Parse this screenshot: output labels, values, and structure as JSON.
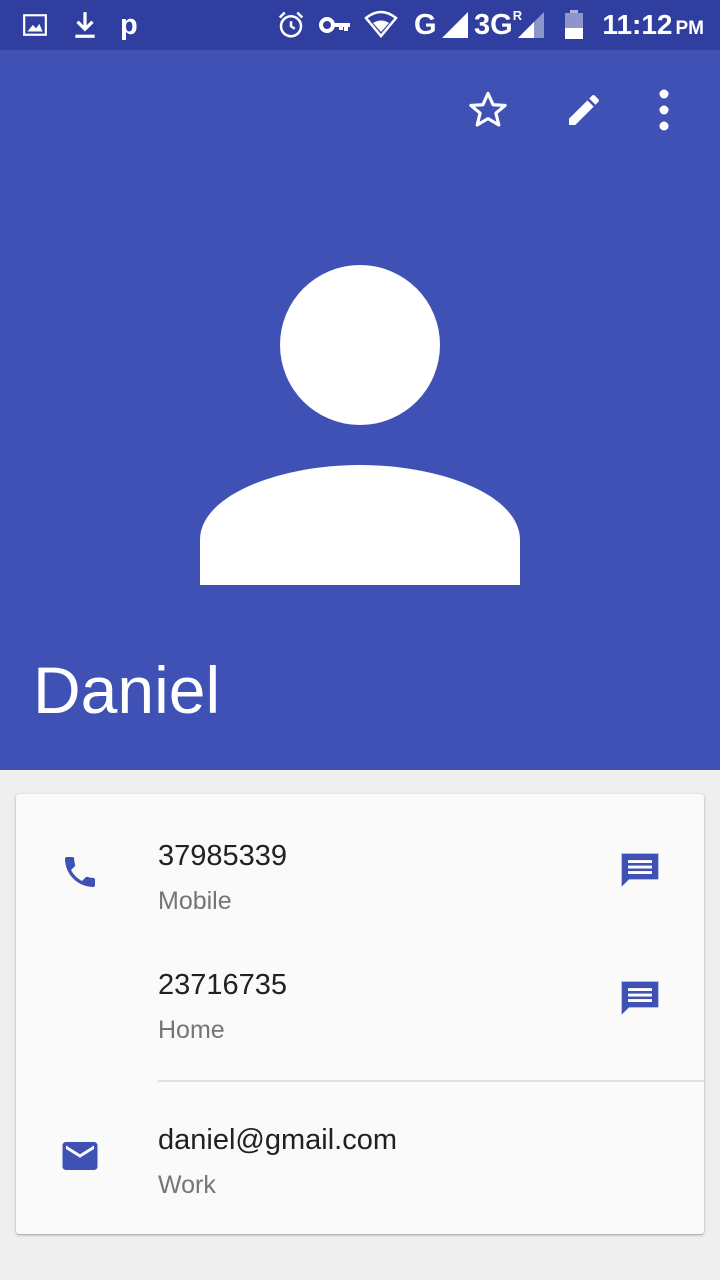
{
  "status_bar": {
    "time": "11:12",
    "ampm": "PM",
    "network_g": "G",
    "network_3g": "3G",
    "roaming": "R",
    "app_icon_letter": "p"
  },
  "toolbar": {
    "icons": [
      "star-outline-icon",
      "edit-pencil-icon",
      "more-vert-icon"
    ]
  },
  "contact": {
    "name": "Daniel",
    "phones": [
      {
        "number": "37985339",
        "type": "Mobile"
      },
      {
        "number": "23716735",
        "type": "Home"
      }
    ],
    "emails": [
      {
        "address": "daniel@gmail.com",
        "type": "Work"
      }
    ]
  },
  "colors": {
    "primary": "#3f51b5",
    "primary_dark": "#303f9f",
    "card_bg": "#fafafa",
    "page_bg": "#efefef",
    "text_primary": "#212121",
    "text_secondary": "#757575"
  }
}
